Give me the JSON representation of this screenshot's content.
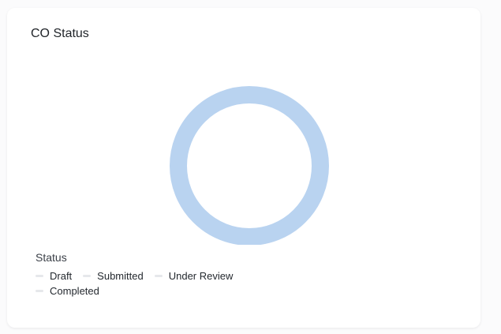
{
  "card": {
    "title": "CO Status"
  },
  "chart_data": {
    "type": "pie",
    "style": "donut",
    "categories": [
      "Draft",
      "Submitted",
      "Under Review",
      "Completed"
    ],
    "values": [
      1,
      0,
      0,
      0
    ],
    "legend_title": "Status",
    "legend_placement": "bottom-left",
    "colors": {
      "ring": "#b9d3f0",
      "legend_swatch": "#e6e8eb"
    }
  }
}
